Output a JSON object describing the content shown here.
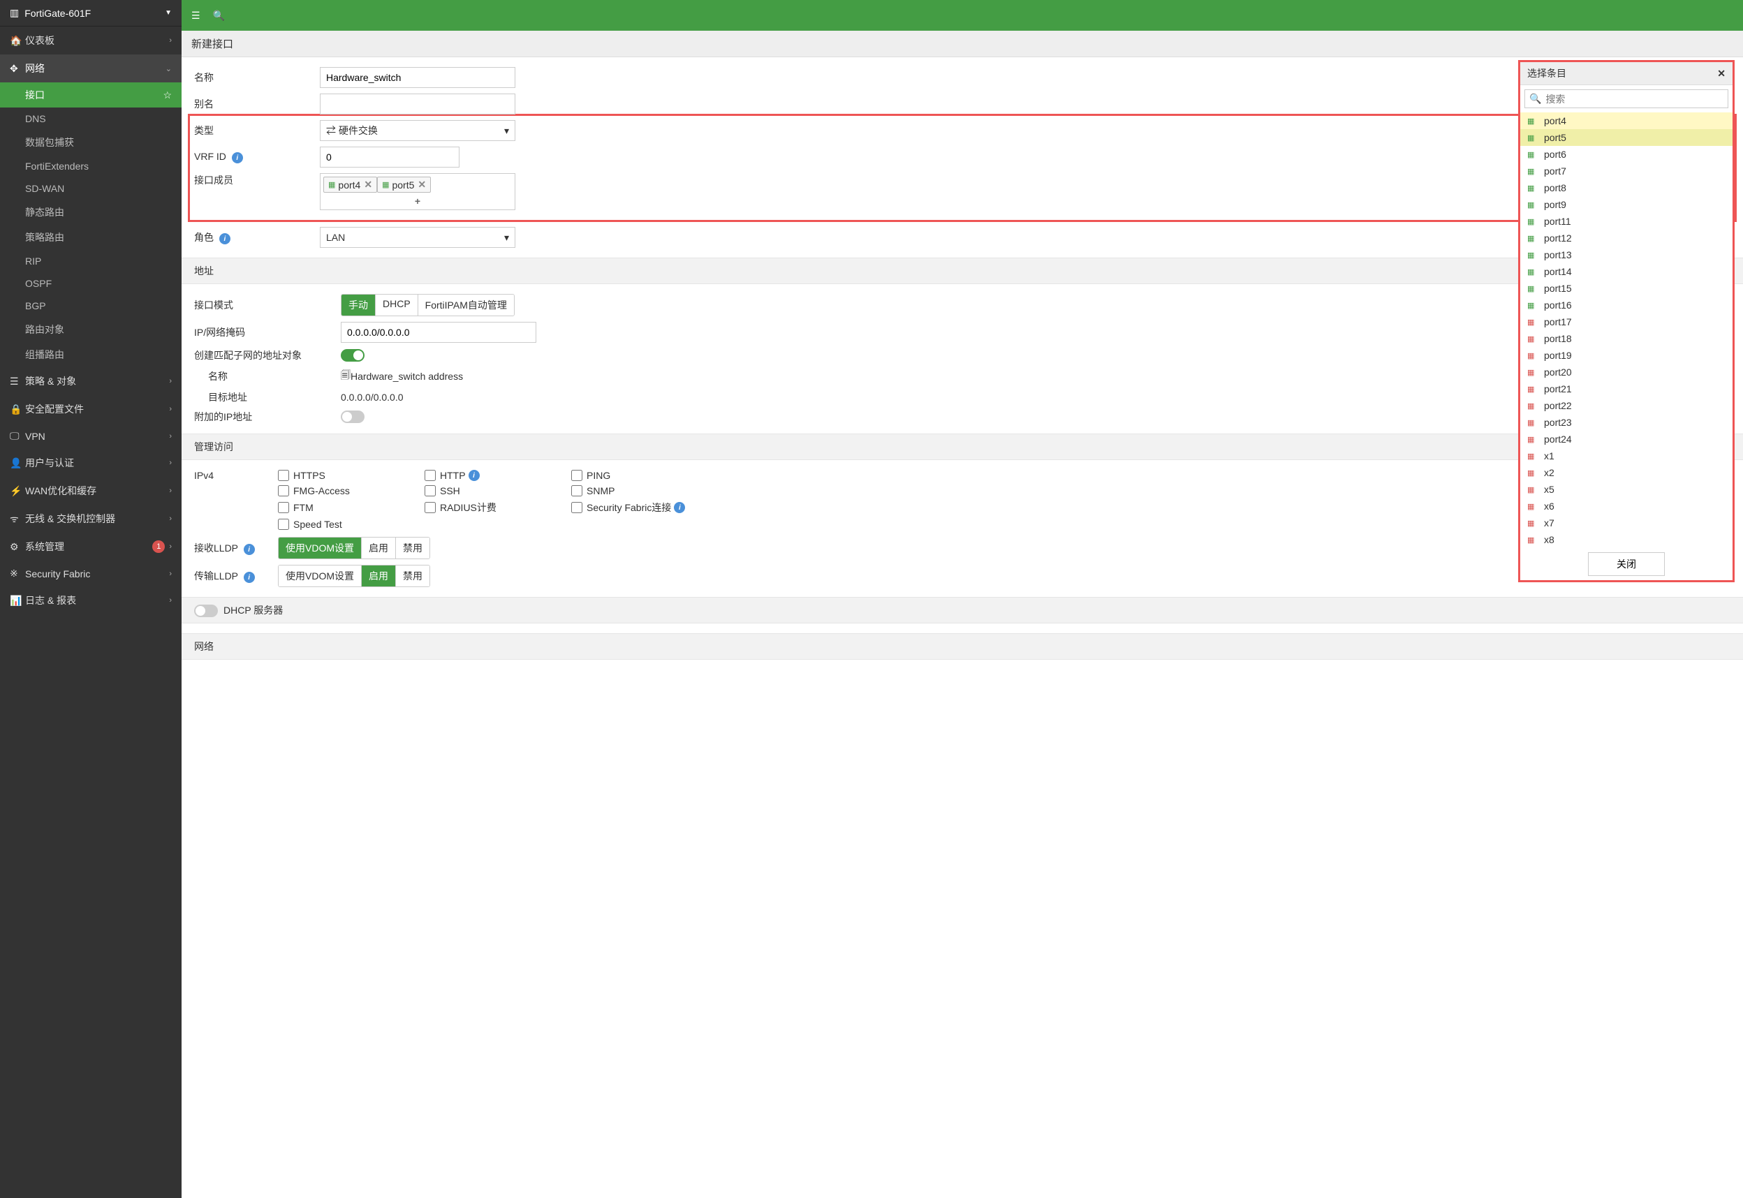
{
  "device": "FortiGate-601F",
  "titlebar": "新建接口",
  "sidebar": {
    "dashboard": "仪表板",
    "network": "网络",
    "net_items": [
      "接口",
      "DNS",
      "数据包捕获",
      "FortiExtenders",
      "SD-WAN",
      "静态路由",
      "策略路由",
      "RIP",
      "OSPF",
      "BGP",
      "路由对象",
      "组播路由"
    ],
    "policy": "策略 & 对象",
    "security": "安全配置文件",
    "vpn": "VPN",
    "user": "用户与认证",
    "wanopt": "WAN优化和缓存",
    "wireless": "无线 & 交换机控制器",
    "system": "系统管理",
    "system_badge": "1",
    "fabric": "Security Fabric",
    "log": "日志 & 报表"
  },
  "form": {
    "name_lbl": "名称",
    "name_val": "Hardware_switch",
    "alias_lbl": "别名",
    "type_lbl": "类型",
    "type_val": "硬件交换",
    "vrf_lbl": "VRF ID",
    "vrf_val": "0",
    "members_lbl": "接口成员",
    "member_chips": [
      "port4",
      "port5"
    ],
    "role_lbl": "角色",
    "role_val": "LAN",
    "addr_hdr": "地址",
    "ifmode_lbl": "接口模式",
    "ifmode_opts": [
      "手动",
      "DHCP",
      "FortiIPAM自动管理"
    ],
    "ipmask_lbl": "IP/网络掩码",
    "ipmask_val": "0.0.0.0/0.0.0.0",
    "create_addr_lbl": "创建匹配子网的地址对象",
    "obj_name_lbl": "名称",
    "obj_name_val": "Hardware_switch address",
    "obj_dest_lbl": "目标地址",
    "obj_dest_val": "0.0.0.0/0.0.0.0",
    "extra_ip_lbl": "附加的IP地址",
    "admin_hdr": "管理访问",
    "ipv4_lbl": "IPv4",
    "cbs": [
      "HTTPS",
      "HTTP",
      "PING",
      "FMG-Access",
      "SSH",
      "SNMP",
      "FTM",
      "RADIUS计费",
      "Security Fabric连接",
      "Speed Test"
    ],
    "rx_lldp_lbl": "接收LLDP",
    "tx_lldp_lbl": "传输LLDP",
    "lldp_opts": [
      "使用VDOM设置",
      "启用",
      "禁用"
    ],
    "dhcp_hdr": "DHCP 服务器",
    "net_hdr": "网络"
  },
  "panel": {
    "title": "选择条目",
    "search_ph": "搜索",
    "close": "关闭",
    "items": [
      {
        "n": "port4",
        "c": "green",
        "s": 1
      },
      {
        "n": "port5",
        "c": "green",
        "s": 2
      },
      {
        "n": "port6",
        "c": "green"
      },
      {
        "n": "port7",
        "c": "green"
      },
      {
        "n": "port8",
        "c": "green"
      },
      {
        "n": "port9",
        "c": "green"
      },
      {
        "n": "port11",
        "c": "green"
      },
      {
        "n": "port12",
        "c": "green"
      },
      {
        "n": "port13",
        "c": "green"
      },
      {
        "n": "port14",
        "c": "green"
      },
      {
        "n": "port15",
        "c": "green"
      },
      {
        "n": "port16",
        "c": "green"
      },
      {
        "n": "port17",
        "c": "red"
      },
      {
        "n": "port18",
        "c": "red"
      },
      {
        "n": "port19",
        "c": "red"
      },
      {
        "n": "port20",
        "c": "red"
      },
      {
        "n": "port21",
        "c": "red"
      },
      {
        "n": "port22",
        "c": "red"
      },
      {
        "n": "port23",
        "c": "red"
      },
      {
        "n": "port24",
        "c": "red"
      },
      {
        "n": "x1",
        "c": "red"
      },
      {
        "n": "x2",
        "c": "red"
      },
      {
        "n": "x5",
        "c": "red"
      },
      {
        "n": "x6",
        "c": "red"
      },
      {
        "n": "x7",
        "c": "red"
      },
      {
        "n": "x8",
        "c": "red"
      }
    ]
  }
}
